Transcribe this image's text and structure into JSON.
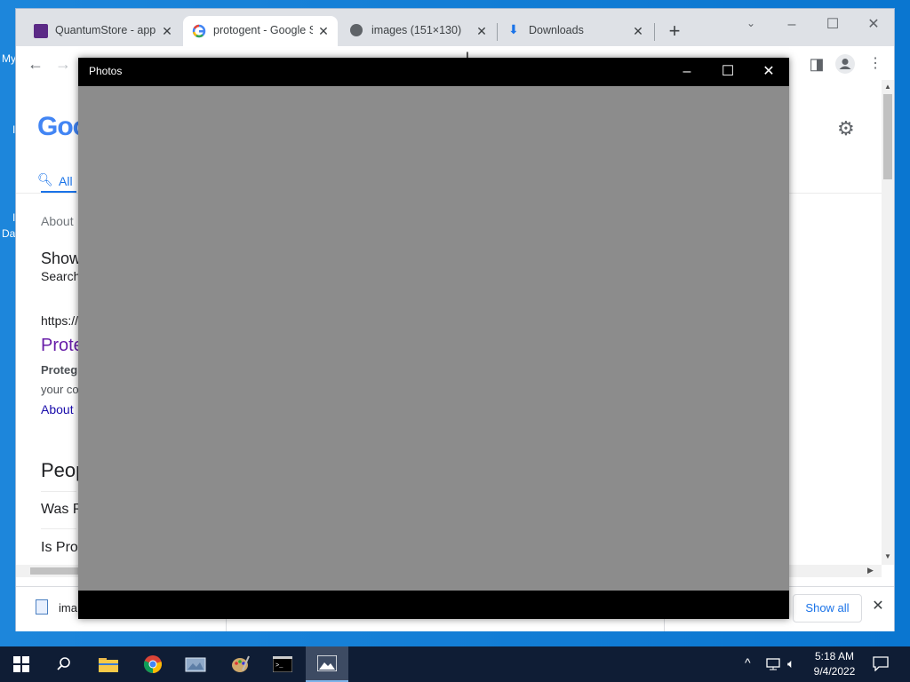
{
  "desktop": {
    "left_labels": [
      "My",
      "Da"
    ],
    "left_glyphs": [
      "I",
      "I"
    ]
  },
  "browser": {
    "tabs": [
      {
        "title": "QuantumStore - app",
        "icon": "quantumstore-favicon"
      },
      {
        "title": "protogent - Google S",
        "icon": "google-favicon"
      },
      {
        "title": "images (151×130)",
        "icon": "globe-favicon"
      },
      {
        "title": "Downloads",
        "icon": "download-favicon"
      }
    ],
    "new_tab_label": "+",
    "page": {
      "google_logo": "Goo",
      "tab_all": "All",
      "about": "About",
      "show_heading": "Show",
      "search_sub": "Search",
      "url": "https://",
      "result_title": "Prote",
      "snippet_bold": "Proteg",
      "snippet_line": "your co",
      "about_link": "About",
      "people_heading": "Peop",
      "q1": "Was P",
      "q2": "Is Pro"
    },
    "download_bar": {
      "item": "ima",
      "show_all": "Show all"
    }
  },
  "photos_app": {
    "title": "Photos"
  },
  "taskbar": {
    "clock_time": "5:18 AM",
    "clock_date": "9/4/2022"
  },
  "colors": {
    "photos_bg": "#8c8c8c",
    "chrome_tabstrip": "#dee1e6",
    "taskbar": "#0f1d35",
    "link": "#1a0dab",
    "visited": "#681da8"
  }
}
